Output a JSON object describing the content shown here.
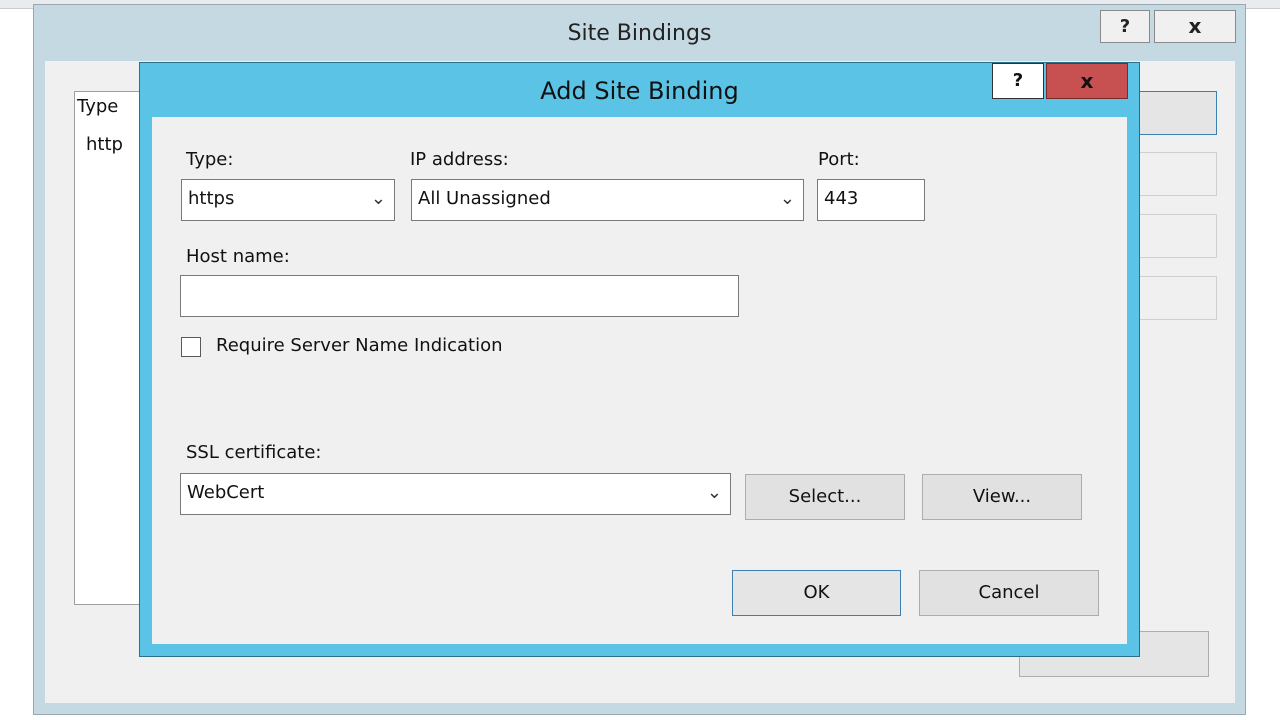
{
  "outer_dialog": {
    "title": "Site Bindings",
    "help_label": "?",
    "close_label": "x",
    "list_header_type": "Type",
    "list_rows": [
      {
        "type": "http"
      }
    ]
  },
  "inner_dialog": {
    "title": "Add Site Binding",
    "help_label": "?",
    "close_label": "x",
    "type_label": "Type:",
    "type_value": "https",
    "ip_label": "IP address:",
    "ip_value": "All Unassigned",
    "port_label": "Port:",
    "port_value": "443",
    "host_label": "Host name:",
    "host_value": "",
    "sni_label": "Require Server Name Indication",
    "sni_checked": false,
    "ssl_label": "SSL certificate:",
    "ssl_value": "WebCert",
    "select_button": "Select...",
    "view_button": "View...",
    "ok_button": "OK",
    "cancel_button": "Cancel"
  },
  "icons": {
    "dropdown": "chevron-down-icon"
  },
  "colors": {
    "inner_frame": "#5bc4e6",
    "close_button": "#c75050",
    "outer_frame": "#c5d9e2"
  }
}
